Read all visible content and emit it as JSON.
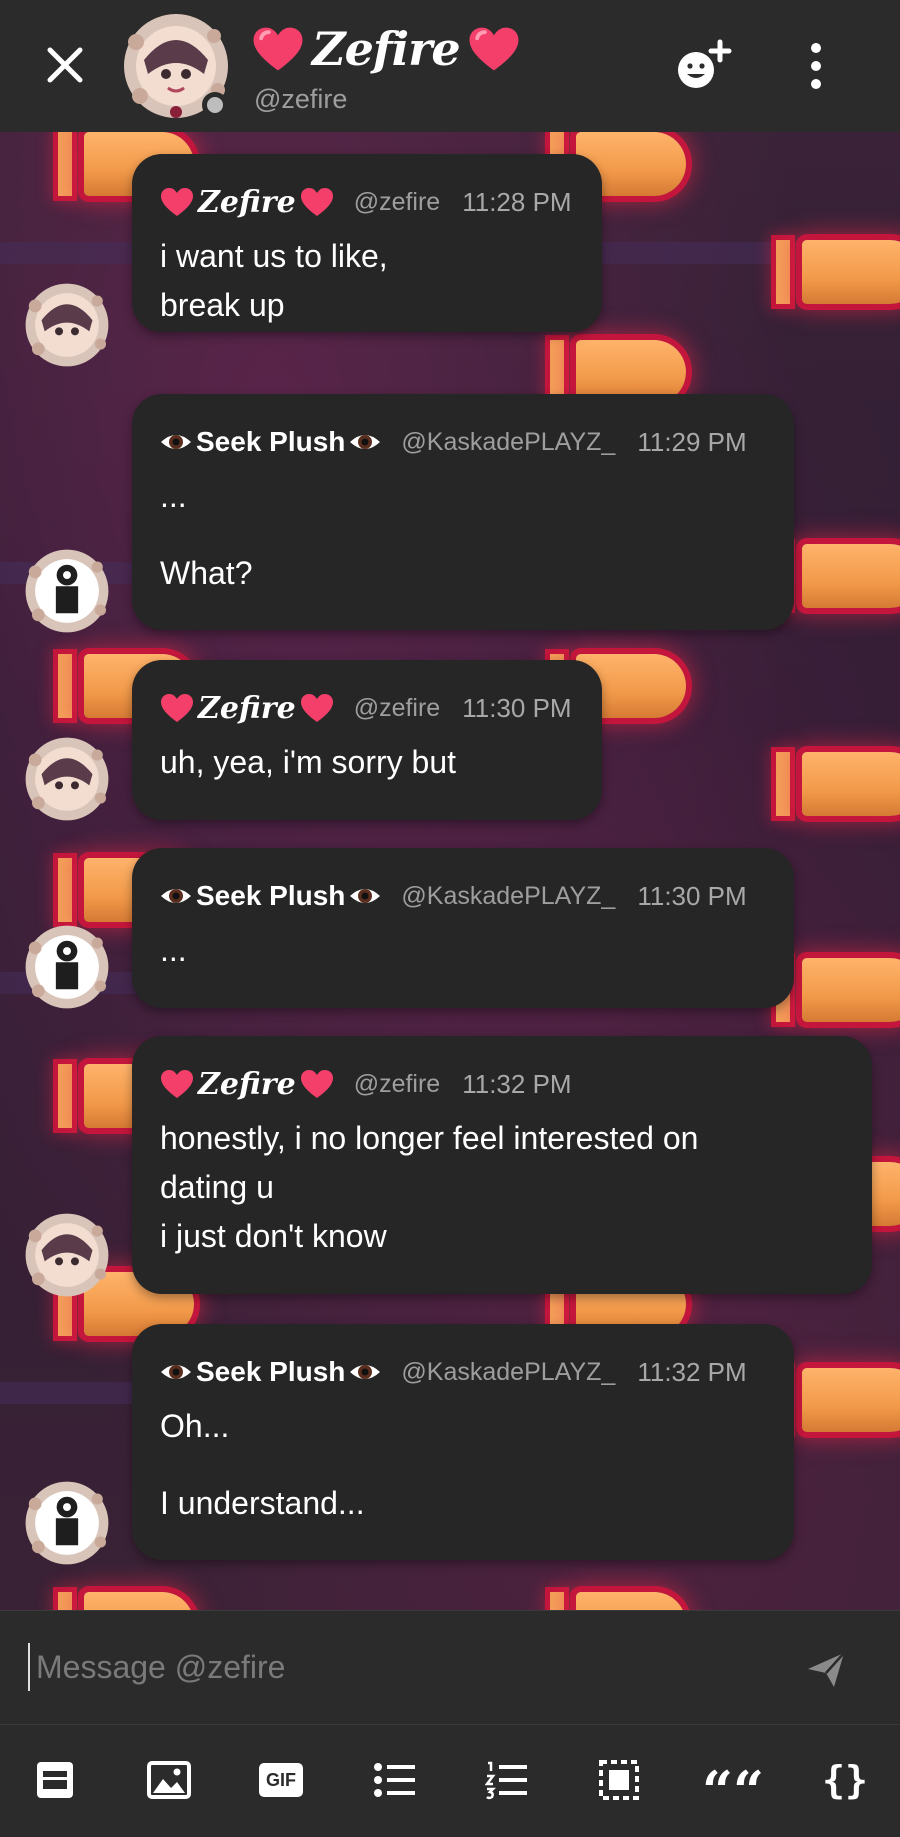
{
  "header": {
    "title": "Zefire",
    "handle": "@zefire",
    "icons": {
      "close": "close-icon",
      "add_member": "add-user-emoji-icon",
      "menu": "more-vertical-icon"
    }
  },
  "messages": [
    {
      "author": "Zefire",
      "author_style": "hearts",
      "handle": "@zefire",
      "time": "11:28 PM",
      "lines": [
        "i want us to like,",
        "break up"
      ]
    },
    {
      "author": "Seek Plush",
      "author_style": "eyes",
      "handle": "@KaskadePLAYZ_",
      "time": "11:29 PM",
      "lines": [
        "...",
        "What?"
      ]
    },
    {
      "author": "Zefire",
      "author_style": "hearts",
      "handle": "@zefire",
      "time": "11:30 PM",
      "lines": [
        "uh, yea, i'm sorry but"
      ]
    },
    {
      "author": "Seek Plush",
      "author_style": "eyes",
      "handle": "@KaskadePLAYZ_",
      "time": "11:30 PM",
      "lines": [
        "..."
      ]
    },
    {
      "author": "Zefire",
      "author_style": "hearts",
      "handle": "@zefire",
      "time": "11:32 PM",
      "lines": [
        "honestly, i no longer feel interested on",
        "dating u",
        "i just don't know"
      ]
    },
    {
      "author": "Seek Plush",
      "author_style": "eyes",
      "handle": "@KaskadePLAYZ_",
      "time": "11:32 PM",
      "lines": [
        "Oh...",
        "I understand..."
      ]
    }
  ],
  "composer": {
    "placeholder": "Message @zefire",
    "send_icon": "send-icon"
  },
  "toolbar": {
    "gif_label": "GIF",
    "quote_label": "““",
    "code_label": "{}",
    "icons": [
      "sticker-icon",
      "image-icon",
      "gif-icon",
      "bullet-list-icon",
      "numbered-list-icon",
      "divider-box-icon",
      "quote-icon",
      "code-icon"
    ]
  },
  "colors": {
    "bubble": "#262626",
    "header": "#2b2b2b",
    "muted_text": "#9e9e9e",
    "heart": "#f43f6b"
  }
}
